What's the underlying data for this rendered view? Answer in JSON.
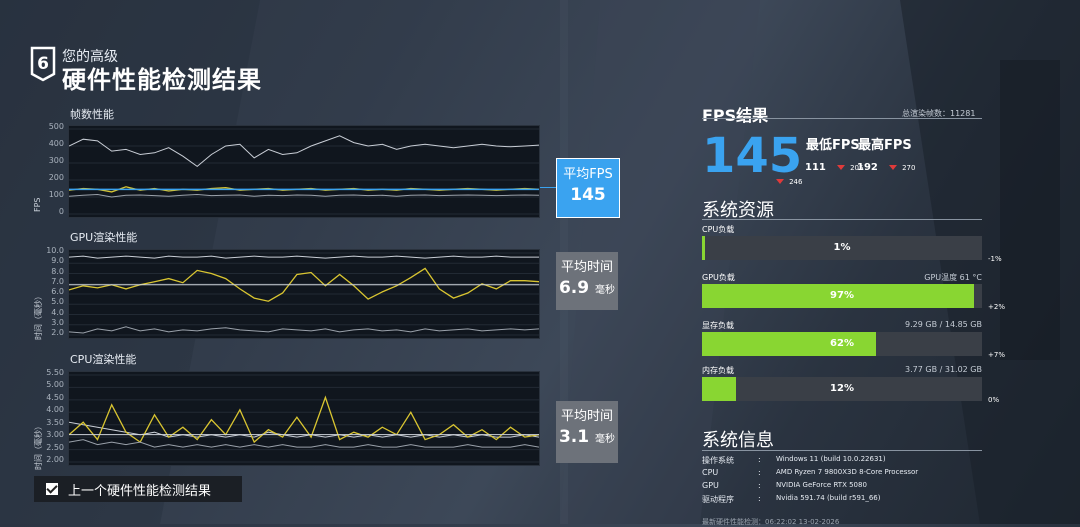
{
  "header": {
    "badge_number": "6",
    "subtitle": "您的高级",
    "title": "硬件性能检测结果"
  },
  "charts": {
    "fps": {
      "label": "帧数性能",
      "y_title": "FPS",
      "y_ticks": [
        "500",
        "400",
        "300",
        "200",
        "100",
        "0"
      ],
      "side_label": "平均FPS",
      "side_value": "145"
    },
    "gpu": {
      "label": "GPU渲染性能",
      "y_title": "时间（毫秒）",
      "y_ticks": [
        "10.0",
        "9.0",
        "8.0",
        "7.0",
        "6.0",
        "5.0",
        "4.0",
        "3.0",
        "2.0"
      ],
      "side_label": "平均时间",
      "side_value": "6.9",
      "side_unit": "毫秒"
    },
    "cpu": {
      "label": "CPU渲染性能",
      "y_title": "时间（毫秒）",
      "y_ticks": [
        "5.50",
        "5.00",
        "4.50",
        "4.00",
        "3.50",
        "3.00",
        "2.50",
        "2.00"
      ],
      "side_label": "平均时间",
      "side_value": "3.1",
      "side_unit": "毫秒"
    }
  },
  "chart_data": [
    {
      "type": "line",
      "title": "帧数性能",
      "ylabel": "FPS",
      "ylim": [
        0,
        500
      ],
      "series": [
        {
          "name": "最高",
          "color": "#c9ced6",
          "values": [
            400,
            440,
            430,
            370,
            380,
            350,
            360,
            390,
            340,
            280,
            350,
            400,
            410,
            330,
            380,
            350,
            360,
            400,
            430,
            460,
            420,
            400,
            410,
            380,
            400,
            410,
            400,
            390,
            400,
            410,
            400,
            395,
            400,
            405
          ]
        },
        {
          "name": "平均",
          "color": "#d9c531",
          "values": [
            140,
            150,
            145,
            130,
            160,
            140,
            150,
            135,
            145,
            140,
            150,
            155,
            140,
            145,
            150,
            140,
            145,
            150,
            140,
            145,
            150,
            140,
            145,
            140,
            150,
            145,
            140,
            145,
            150,
            145,
            140,
            145,
            150,
            145
          ]
        },
        {
          "name": "最低",
          "color": "#9aa1aa",
          "values": [
            105,
            110,
            115,
            100,
            110,
            112,
            108,
            105,
            110,
            115,
            108,
            110,
            112,
            105,
            110,
            108,
            112,
            110,
            105,
            110,
            112,
            108,
            110,
            105,
            110,
            112,
            108,
            110,
            112,
            110,
            108,
            110,
            112,
            110
          ]
        }
      ],
      "avg_line": 145
    },
    {
      "type": "line",
      "title": "GPU渲染性能",
      "ylabel": "时间（毫秒）",
      "ylim": [
        2,
        10
      ],
      "series": [
        {
          "name": "最高",
          "color": "#c9ced6",
          "values": [
            9.6,
            9.7,
            9.5,
            9.6,
            9.7,
            9.6,
            9.5,
            9.7,
            9.6,
            9.6,
            9.7,
            9.5,
            9.6,
            9.7,
            9.6,
            9.6,
            9.7,
            9.6,
            9.5,
            9.6,
            9.7,
            9.6,
            9.6,
            9.7,
            9.6,
            9.5,
            9.6,
            9.7,
            9.6,
            9.6,
            9.7,
            9.6,
            9.6,
            9.6
          ]
        },
        {
          "name": "平均",
          "color": "#d9c531",
          "values": [
            6.4,
            6.8,
            6.6,
            6.9,
            6.5,
            6.9,
            7.2,
            7.5,
            7.1,
            8.3,
            8.0,
            7.5,
            6.5,
            5.6,
            5.3,
            6.1,
            7.9,
            8.1,
            6.8,
            7.9,
            6.8,
            5.5,
            6.2,
            6.8,
            7.6,
            8.5,
            6.5,
            5.6,
            6.1,
            7.0,
            6.5,
            7.3,
            7.3,
            7.2
          ]
        },
        {
          "name": "最低",
          "color": "#9aa1aa",
          "values": [
            2.3,
            2.2,
            2.6,
            2.4,
            2.8,
            2.4,
            2.6,
            2.3,
            2.5,
            2.4,
            2.6,
            2.7,
            2.5,
            2.4,
            2.3,
            2.6,
            2.5,
            2.4,
            2.6,
            2.3,
            2.5,
            2.6,
            2.4,
            2.5,
            2.3,
            2.6,
            2.4,
            2.5,
            2.6,
            2.4,
            2.5,
            2.6,
            2.5,
            2.6
          ]
        }
      ],
      "avg_line": 6.9
    },
    {
      "type": "line",
      "title": "CPU渲染性能",
      "ylabel": "时间（毫秒）",
      "ylim": [
        2,
        5.5
      ],
      "series": [
        {
          "name": "最高",
          "color": "#c9ced6",
          "values": [
            3.6,
            3.5,
            3.4,
            3.3,
            3.2,
            3.1,
            3.2,
            3.0,
            3.1,
            3.0,
            3.1,
            3.0,
            3.1,
            3.0,
            3.2,
            3.1,
            3.0,
            3.1,
            3.0,
            3.1,
            3.0,
            3.1,
            3.0,
            3.1,
            3.0,
            3.1,
            3.0,
            3.1,
            3.0,
            3.1,
            3.0,
            3.0,
            3.1,
            3.0
          ]
        },
        {
          "name": "平均",
          "color": "#d9c531",
          "values": [
            3.1,
            3.6,
            2.9,
            4.3,
            3.2,
            2.8,
            3.9,
            3.0,
            3.4,
            2.9,
            3.7,
            3.1,
            4.1,
            2.8,
            3.3,
            3.0,
            3.8,
            3.0,
            4.6,
            2.9,
            3.2,
            3.0,
            3.4,
            3.1,
            4.0,
            2.9,
            3.1,
            3.5,
            3.0,
            3.3,
            2.9,
            3.4,
            3.0,
            3.1
          ]
        },
        {
          "name": "最低",
          "color": "#9aa1aa",
          "values": [
            2.8,
            2.9,
            2.7,
            2.8,
            2.7,
            2.8,
            2.6,
            2.7,
            2.6,
            2.7,
            2.6,
            2.7,
            2.6,
            2.7,
            2.6,
            2.7,
            2.6,
            2.6,
            2.7,
            2.6,
            2.6,
            2.7,
            2.6,
            2.6,
            2.7,
            2.6,
            2.6,
            2.6,
            2.7,
            2.6,
            2.6,
            2.6,
            2.7,
            2.6
          ]
        }
      ],
      "avg_line": 3.1
    }
  ],
  "prev_result": {
    "label": "上一个硬件性能检测结果",
    "checked": true
  },
  "fps_result": {
    "title": "FPS结果",
    "total_frames_label": "总渲染帧数：11281",
    "avg": "145",
    "avg_delta": "246",
    "min_label": "最低FPS",
    "max_label": "最高FPS",
    "min": "111",
    "min_delta": "205",
    "max": "192",
    "max_delta": "270"
  },
  "resources": {
    "title": "系统资源",
    "items": [
      {
        "label": "CPU负载",
        "value_pct": 1,
        "value_text": "1%",
        "extra": "",
        "delta": "-1%"
      },
      {
        "label": "GPU负载",
        "value_pct": 97,
        "value_text": "97%",
        "extra": "GPU温度 61 °C",
        "delta": "+2%"
      },
      {
        "label": "显存负载",
        "value_pct": 62,
        "value_text": "62%",
        "extra": "9.29 GB / 14.85 GB",
        "delta": "+7%"
      },
      {
        "label": "内存负载",
        "value_pct": 12,
        "value_text": "12%",
        "extra": "3.77 GB / 31.02 GB",
        "delta": "0%"
      }
    ]
  },
  "sysinfo": {
    "title": "系统信息",
    "rows": [
      {
        "k": "操作系统",
        "v": "Windows 11 (build 10.0.22631)"
      },
      {
        "k": "CPU",
        "v": "AMD Ryzen 7 9800X3D 8-Core Processor"
      },
      {
        "k": "GPU",
        "v": "NVIDIA GeForce RTX 5080"
      },
      {
        "k": "驱动程序",
        "v": "Nvidia 591.74 (build r591_66)"
      }
    ],
    "last_test": "最新硬件性能检测：06:22:02 13-02-2026"
  },
  "colors": {
    "accent_blue": "#3aa3f0",
    "bar_green": "#89d632",
    "delta_red": "#e03a3a",
    "avg_yellow": "#d9c531"
  }
}
